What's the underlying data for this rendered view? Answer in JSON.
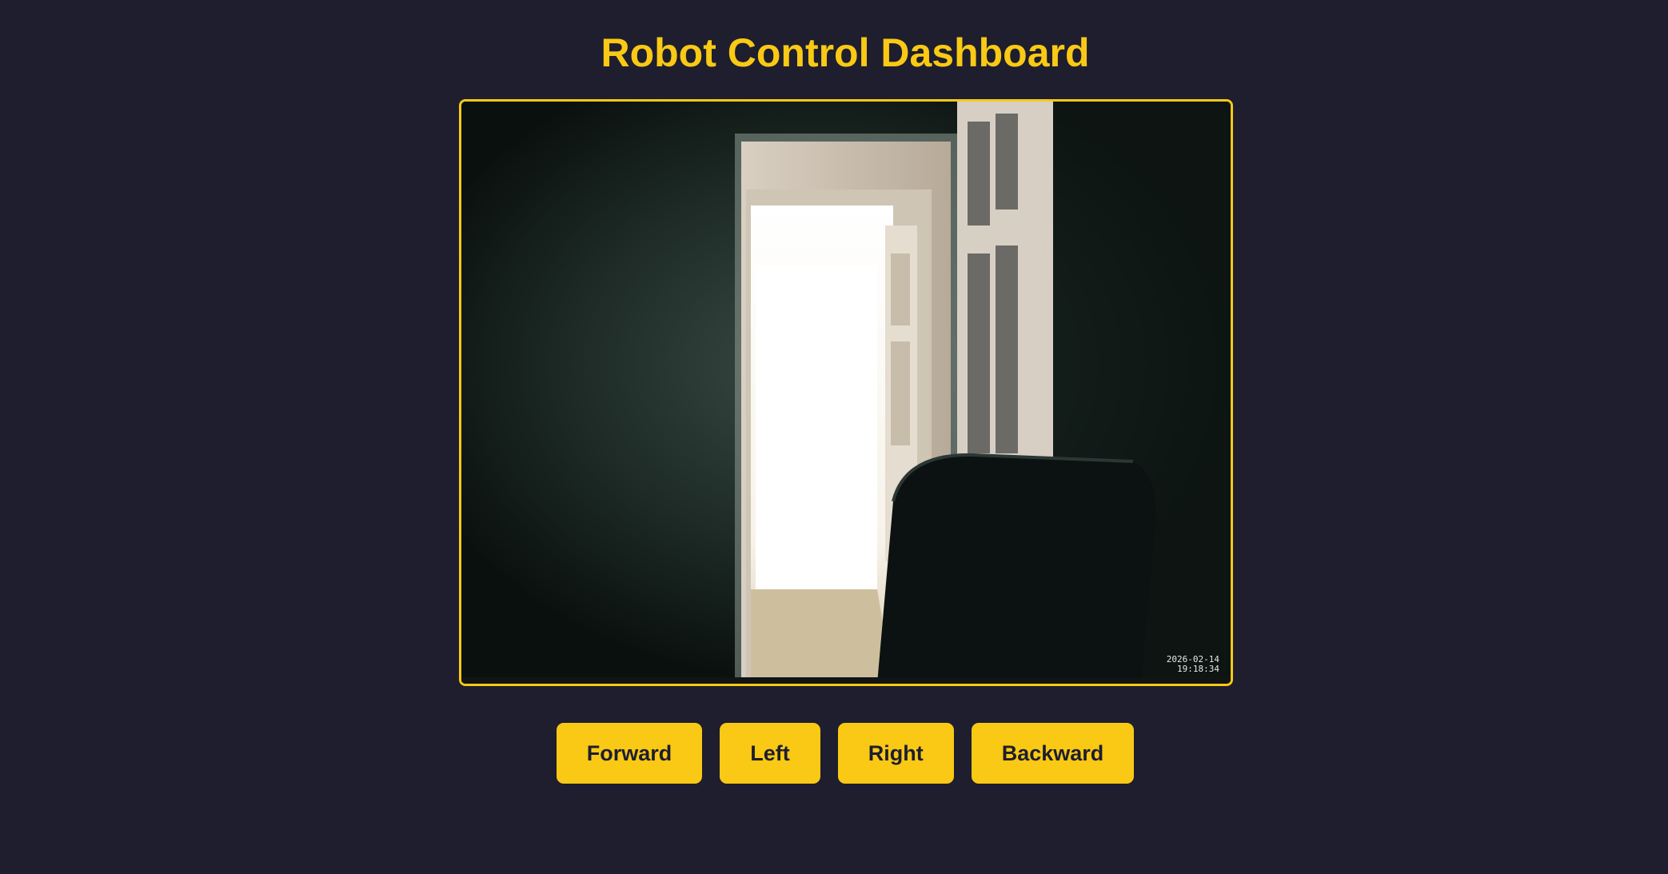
{
  "header": {
    "title": "Robot Control Dashboard"
  },
  "camera": {
    "timestamp_date": "2026-02-14",
    "timestamp_time": "19:18:34"
  },
  "controls": {
    "forward_label": "Forward",
    "left_label": "Left",
    "right_label": "Right",
    "backward_label": "Backward"
  },
  "colors": {
    "background": "#1e1e2e",
    "accent": "#f9c915",
    "button_text": "#1e1e2e"
  }
}
